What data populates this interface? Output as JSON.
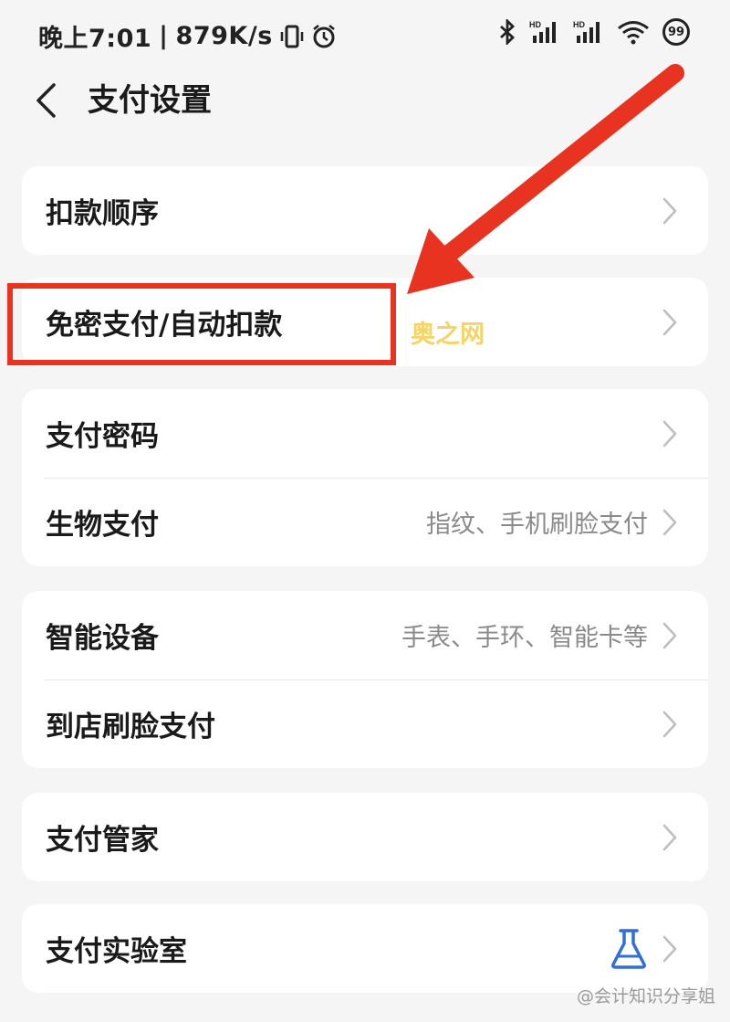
{
  "status_bar": {
    "time": "晚上7:01",
    "separator": "|",
    "net_speed": "879K/s",
    "battery": "99",
    "hd_label": "HD",
    "icons": [
      "vibrate-icon",
      "alarm-icon",
      "bluetooth-icon",
      "signal-icon",
      "wifi-icon",
      "battery-icon"
    ]
  },
  "header": {
    "title": "支付设置"
  },
  "groups": [
    {
      "rows": [
        {
          "label": "扣款顺序"
        }
      ]
    },
    {
      "rows": [
        {
          "label": "免密支付/自动扣款"
        }
      ]
    },
    {
      "rows": [
        {
          "label": "支付密码"
        },
        {
          "label": "生物支付",
          "value": "指纹、手机刷脸支付"
        }
      ]
    },
    {
      "rows": [
        {
          "label": "智能设备",
          "value": "手表、手环、智能卡等"
        },
        {
          "label": "到店刷脸支付"
        }
      ]
    },
    {
      "rows": [
        {
          "label": "支付管家"
        }
      ]
    },
    {
      "rows": [
        {
          "label": "支付实验室",
          "icon": "flask-icon"
        }
      ]
    }
  ],
  "watermark": "奥之网",
  "footer": "@会计知识分享姐",
  "colors": {
    "annotation": "#e7331f",
    "accent": "#2f6fd6",
    "background": "#f5f5f5"
  }
}
